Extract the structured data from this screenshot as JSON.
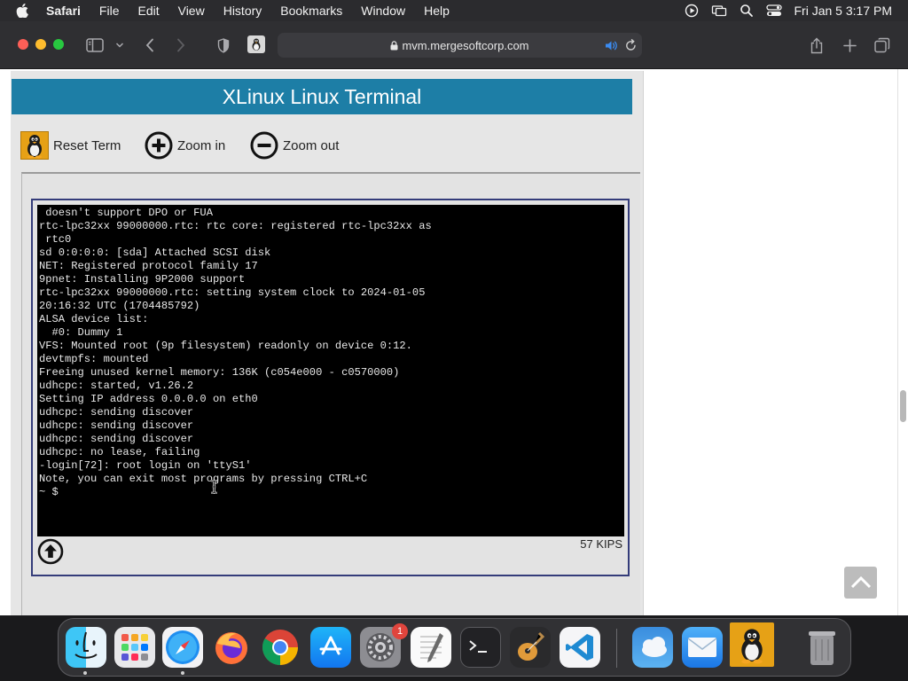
{
  "menubar": {
    "app_name": "Safari",
    "items": [
      "File",
      "Edit",
      "View",
      "History",
      "Bookmarks",
      "Window",
      "Help"
    ],
    "clock": "Fri Jan 5  3:17 PM"
  },
  "browser": {
    "url": "mvm.mergesoftcorp.com"
  },
  "app": {
    "title": "XLinux Linux Terminal",
    "reset_label": "Reset Term",
    "zoom_in_label": "Zoom in",
    "zoom_out_label": "Zoom out",
    "speed": "57 KIPS"
  },
  "terminal": {
    "lines": [
      " doesn't support DPO or FUA",
      "rtc-lpc32xx 99000000.rtc: rtc core: registered rtc-lpc32xx as",
      " rtc0",
      "sd 0:0:0:0: [sda] Attached SCSI disk",
      "NET: Registered protocol family 17",
      "9pnet: Installing 9P2000 support",
      "rtc-lpc32xx 99000000.rtc: setting system clock to 2024-01-05",
      "20:16:32 UTC (1704485792)",
      "ALSA device list:",
      "  #0: Dummy 1",
      "VFS: Mounted root (9p filesystem) readonly on device 0:12.",
      "devtmpfs: mounted",
      "Freeing unused kernel memory: 136K (c054e000 - c0570000)",
      "udhcpc: started, v1.26.2",
      "Setting IP address 0.0.0.0 on eth0",
      "udhcpc: sending discover",
      "udhcpc: sending discover",
      "udhcpc: sending discover",
      "udhcpc: no lease, failing",
      "-login[72]: root login on 'ttyS1'",
      "Note, you can exit most programs by pressing CTRL+C",
      "~ $"
    ]
  },
  "dock": {
    "apps": [
      "finder",
      "launchpad",
      "safari",
      "firefox",
      "chrome",
      "app-store",
      "system-settings",
      "textedit",
      "terminal",
      "garageband",
      "vscode",
      "weather",
      "mail",
      "xlinux",
      "trash"
    ],
    "settings_badge": "1"
  },
  "colors": {
    "title_bar": "#1d7ea6",
    "terminal_bg": "#000000",
    "terminal_frame": "#343c7a"
  }
}
